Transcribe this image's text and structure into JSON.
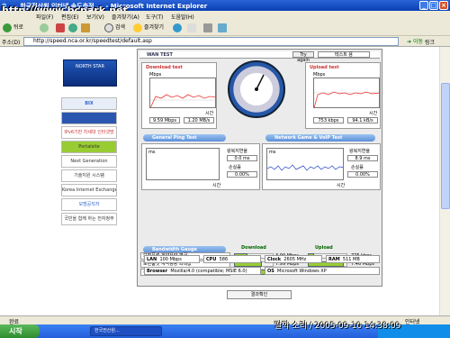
{
  "window": {
    "title": "...  한국전산원  인터넷 속도측정 ... - Microsoft Internet Explorer",
    "watermark": "http://www.bcpark.net"
  },
  "menu": {
    "items": [
      "파일(F)",
      "편집(E)",
      "보기(V)",
      "즐겨찾기(A)",
      "도구(T)",
      "도움말(H)"
    ]
  },
  "toolbar": {
    "back": "뒤로",
    "search": "검색",
    "favorites": "즐겨찾기"
  },
  "address": {
    "label": "주소(D)",
    "url": "http://speed.nca.or.kr/speedtest/default.asp",
    "go": "이동",
    "links": "링크"
  },
  "leftnav": {
    "banners": [
      "BIX",
      "",
      "IPv6기반 차세대 인터넷망",
      "Portalsite",
      "Next Generation",
      "기술지원 시스템",
      "Korea Internet Exchange",
      "모범공직자",
      "국민을 함께 하는 전자정부"
    ]
  },
  "wan": {
    "title": "WAN TEST",
    "try_again": "Try again",
    "server": "테스트 용",
    "download": {
      "label": "Download test",
      "unit": "Mbps",
      "time": "시간",
      "speed_value": "9.59 Mbps",
      "peak_value": "1.20 MB/s"
    },
    "upload": {
      "label": "Upload test",
      "unit": "Mbps",
      "time": "시간",
      "speed_value": "753 kbps",
      "peak_value": "94.1 kB/s"
    },
    "ping": {
      "title": "General Ping Test",
      "unit": "ms",
      "time": "시간",
      "rtt_label": "왕복지연율",
      "rtt_value": "0.0 ms",
      "loss_label": "손실률",
      "loss_value": "0.00%"
    },
    "voip": {
      "title": "Network Game & VoIP Test",
      "unit": "ms",
      "time": "시간",
      "rtt_label": "왕복지연율",
      "rtt_value": "8.9 ms",
      "loss_label": "손실률",
      "loss_value": "0.00%"
    },
    "bandwidth": {
      "title": "Bandwidth Gauge",
      "download_label": "Download",
      "upload_label": "Upload",
      "rows": [
        {
          "label": "보편품셋 계약용량 평균",
          "down": "3.99 Mbps",
          "down_frac": 0.35,
          "up": "775 kbps",
          "up_frac": 0.15
        },
        {
          "label": "보편품셋 계약용량 최대값",
          "down": "7.99 Mbps",
          "down_frac": 0.7,
          "up": "7.46 Mbps",
          "up_frac": 0.9
        },
        {
          "label": "사용자 측정값",
          "down": "9.59 Mbps",
          "down_frac": 0.84,
          "up": "753 kbps",
          "up_frac": 0.15
        }
      ]
    },
    "system": {
      "lan_label": "LAN",
      "lan_value": "100 Mbps",
      "cpu_label": "CPU",
      "cpu_value": "586",
      "clock_label": "Clock",
      "clock_value": "2605 MHz",
      "ram_label": "RAM",
      "ram_value": "511 MB",
      "browser_label": "Browser",
      "browser_value": "Mozilla/4.0 (compatible; MSIE 6.0)",
      "os_label": "OS",
      "os_value": "Microsoft Windows XP"
    },
    "confirm": "결과확인"
  },
  "status": {
    "text": "완료",
    "zone": "인터넷"
  },
  "taskbar": {
    "start": "시작",
    "task": "한국전산원...",
    "caption": "딸깍 소리 / 2005-09-10 14:38:09"
  }
}
